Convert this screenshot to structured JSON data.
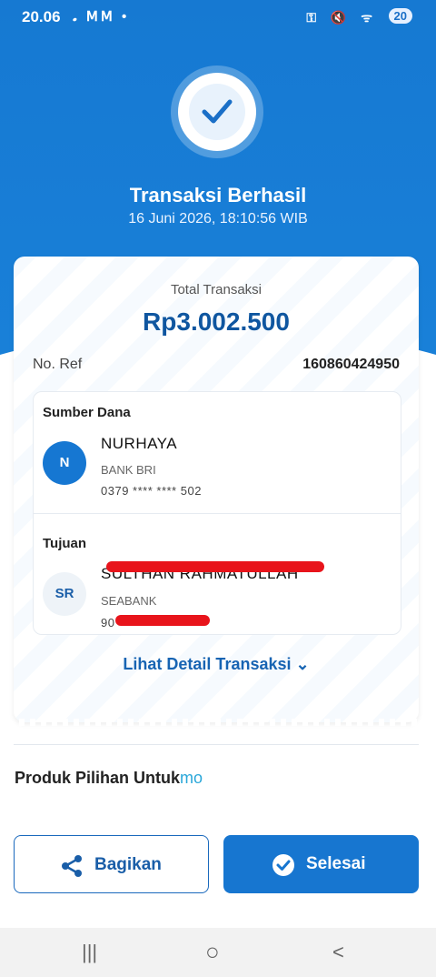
{
  "status_bar": {
    "time": "20.06",
    "left_icons": "𝅘 ⅯⅯ •",
    "right_icons": "⚿ 🔇 ᯤ",
    "battery": "20"
  },
  "header": {
    "title": "Transaksi Berhasil",
    "datetime": "16 Juni 2026, 18:10:56 WIB",
    "icon": "check-icon"
  },
  "summary": {
    "total_label": "Total Transaksi",
    "total_value": "Rp3.002.500",
    "ref_label": "No. Ref",
    "ref_value": "160860424950"
  },
  "source": {
    "section_title": "Sumber Dana",
    "avatar_initial": "N",
    "name": "NURHAYA",
    "bank": "BANK BRI",
    "account": "0379 **** **** 502"
  },
  "destination": {
    "section_title": "Tujuan",
    "avatar_initial": "SR",
    "name": "SULTHAN RAHMATULLAH",
    "bank": "SEABANK",
    "account": "90"
  },
  "detail_link": "Lihat Detail Transaksi ⌄",
  "produk": {
    "title": "Produk Pilihan Untuk",
    "suffix": "mo"
  },
  "buttons": {
    "share_label": "Bagikan",
    "done_label": "Selesai"
  },
  "nav": {
    "recents": "|||",
    "home": "○",
    "back": "<"
  },
  "colors": {
    "primary": "#1776d0",
    "dark_blue": "#0f56a0",
    "redaction": "#e8141b"
  }
}
